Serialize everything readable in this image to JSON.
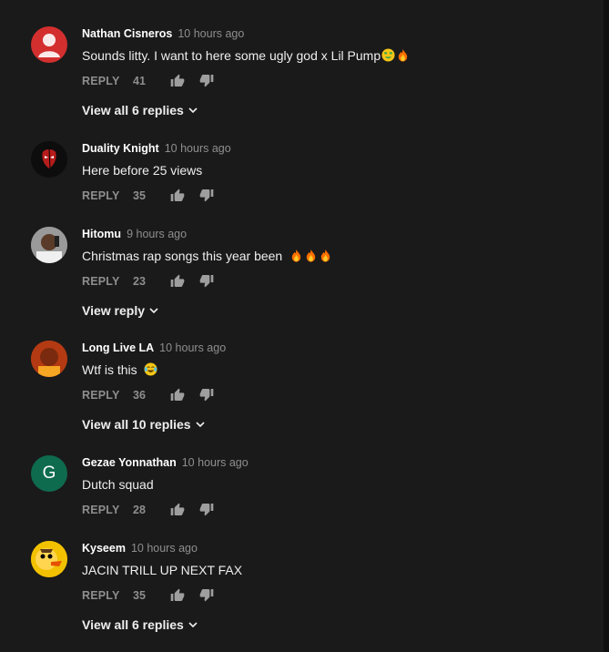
{
  "comments": [
    {
      "author": "Nathan Cisneros",
      "time": "10 hours ago",
      "text": "Sounds litty. I want to here some ugly god x Lil Pump",
      "reply_label": "REPLY",
      "likes": "41",
      "view_replies": "View all 6 replies",
      "avatar_color": "#d32f2f",
      "avatar_icon": "default-user-icon",
      "emojis": [
        "money-mouth-face",
        "fire"
      ]
    },
    {
      "author": "Duality Knight",
      "time": "10 hours ago",
      "text": "Here before 25 views",
      "reply_label": "REPLY",
      "likes": "35",
      "avatar_color": "#111111"
    },
    {
      "author": "Hitomu",
      "time": "9 hours ago",
      "text": "Christmas rap songs this year been",
      "reply_label": "REPLY",
      "likes": "23",
      "view_replies": "View reply",
      "avatar_color": "#8a8a8a",
      "emojis": [
        "fire",
        "fire",
        "fire"
      ]
    },
    {
      "author": "Long Live LA",
      "time": "10 hours ago",
      "text": "Wtf is this",
      "reply_label": "REPLY",
      "likes": "36",
      "view_replies": "View all 10 replies",
      "avatar_color": "#c24a1e",
      "emojis": [
        "face-with-tears-of-joy"
      ]
    },
    {
      "author": "Gezae Yonnathan",
      "time": "10 hours ago",
      "text": "Dutch squad",
      "reply_label": "REPLY",
      "likes": "28",
      "avatar_color": "#0e6b4e",
      "avatar_letter": "G"
    },
    {
      "author": "Kyseem",
      "time": "10 hours ago",
      "text": "JACIN TRILL UP NEXT FAX",
      "reply_label": "REPLY",
      "likes": "35",
      "view_replies": "View all 6 replies",
      "avatar_color": "#f2c100"
    }
  ]
}
